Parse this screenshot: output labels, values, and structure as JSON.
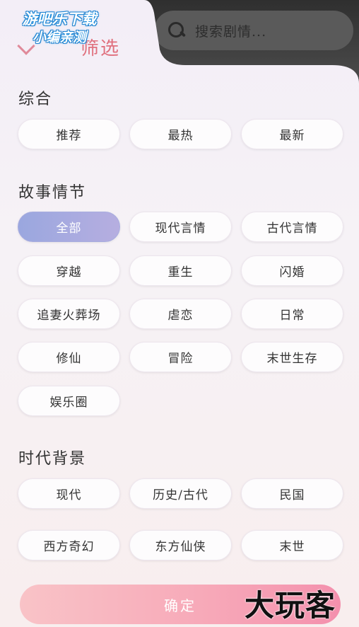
{
  "search": {
    "placeholder": "搜索剧情..."
  },
  "header": {
    "title": "筛选"
  },
  "watermark": {
    "line1": "游吧乐下载",
    "line2": "小编亲测"
  },
  "sections": [
    {
      "title": "综合",
      "options": [
        "推荐",
        "最热",
        "最新"
      ]
    },
    {
      "title": "故事情节",
      "options": [
        "全部",
        "现代言情",
        "古代言情",
        "穿越",
        "重生",
        "闪婚",
        "追妻火葬场",
        "虐恋",
        "日常",
        "修仙",
        "冒险",
        "末世生存",
        "娱乐圈"
      ],
      "selected": "全部"
    },
    {
      "title": "时代背景",
      "options": [
        "现代",
        "历史/古代",
        "民国",
        "西方奇幻",
        "东方仙侠",
        "末世"
      ]
    }
  ],
  "confirm_label": "确定",
  "brand_text": "大玩客",
  "colors": {
    "accent_active": "#a3aade",
    "confirm": "#f7a8b8",
    "title": "#e0707e"
  }
}
